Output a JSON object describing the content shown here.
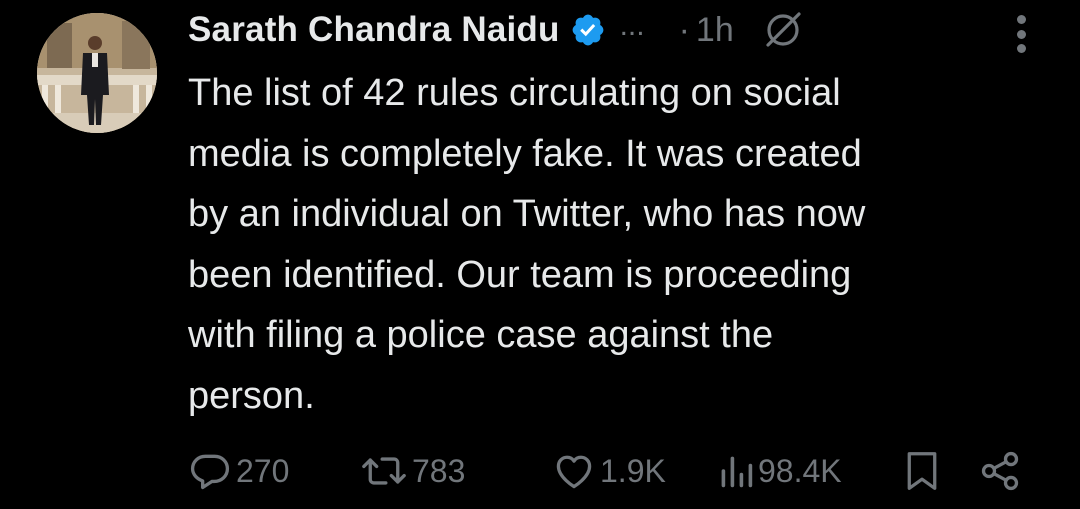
{
  "tweet": {
    "author_name": "Sarath Chandra Naidu",
    "handle_truncated": "...",
    "time_separator": "·",
    "time": "1h",
    "text": "The list of 42 rules circulating on social\nmedia is completely fake. It was created\nby an individual on Twitter, who has now\nbeen identified. Our team is proceeding\nwith filing a police case against the\nperson.",
    "verified": true
  },
  "actions": {
    "replies": "270",
    "reposts": "783",
    "likes": "1.9K",
    "views": "98.4K"
  },
  "colors": {
    "background": "#000000",
    "text_primary": "#e7e9ea",
    "text_secondary": "#71767b",
    "verified_badge": "#1d9bf0"
  },
  "icons": {
    "verified": "verified-badge-icon",
    "grok": "grok-icon",
    "more": "more-vertical-icon",
    "reply": "reply-icon",
    "repost": "repost-icon",
    "like": "heart-icon",
    "views": "views-bar-chart-icon",
    "bookmark": "bookmark-icon",
    "share": "share-icon"
  }
}
